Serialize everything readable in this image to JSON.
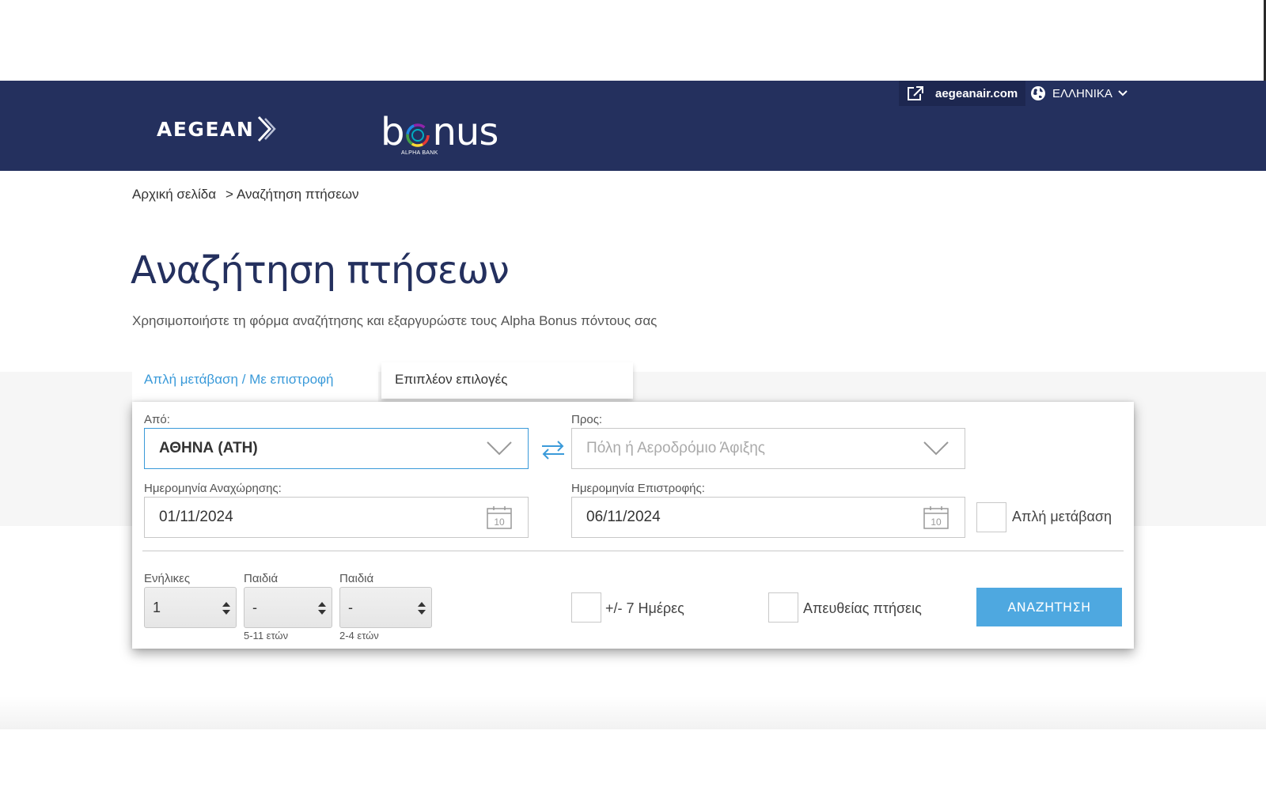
{
  "header": {
    "aegean_logo": "AEGEAN",
    "bonus_logo": "bonus",
    "bonus_logo_sub": "ALPHA BANK",
    "external_link": "aegeanair.com",
    "language": "ΕΛΛΗΝΙΚΑ",
    "bg_color": "#24305e"
  },
  "breadcrumb": {
    "home": "Αρχική σελίδα",
    "separator": ">",
    "current": "Αναζήτηση πτήσεων"
  },
  "page": {
    "title": "Αναζήτηση πτήσεων",
    "subtitle": "Χρησιμοποιήστε τη φόρμα αναζήτησης και εξαργυρώστε τους Alpha Bonus πόντους σας"
  },
  "tabs": [
    {
      "label": "Απλή μετάβαση / Με επιστροφή",
      "active": true
    },
    {
      "label": "Επιπλέον επιλογές",
      "active": false
    }
  ],
  "form": {
    "from_label": "Από:",
    "from_value": "ΑΘΗΝΑ (ATH)",
    "to_label": "Προς:",
    "to_placeholder": "Πόλη ή Αεροδρόμιο Άφιξης",
    "departure_label": "Ημερομηνία Αναχώρησης:",
    "departure_value": "01/11/2024",
    "return_label": "Ημερομηνία Επιστροφής:",
    "return_value": "06/11/2024",
    "calendar_day": "10",
    "one_way_label": "Απλή μετάβαση",
    "adults_label": "Ενήλικες",
    "adults_value": "1",
    "children_label": "Παιδιά",
    "children_value": "-",
    "children_note": "5-11 ετών",
    "infants_label": "Παιδιά",
    "infants_value": "-",
    "infants_note": "2-4 ετών",
    "flex_days_label": "+/- 7 Ημέρες",
    "direct_label": "Απευθείας πτήσεις",
    "search_button": "ΑΝΑΖΗΤΗΣΗ"
  },
  "colors": {
    "accent": "#3a9ad9",
    "button": "#4ea8e0",
    "title": "#24305e"
  }
}
